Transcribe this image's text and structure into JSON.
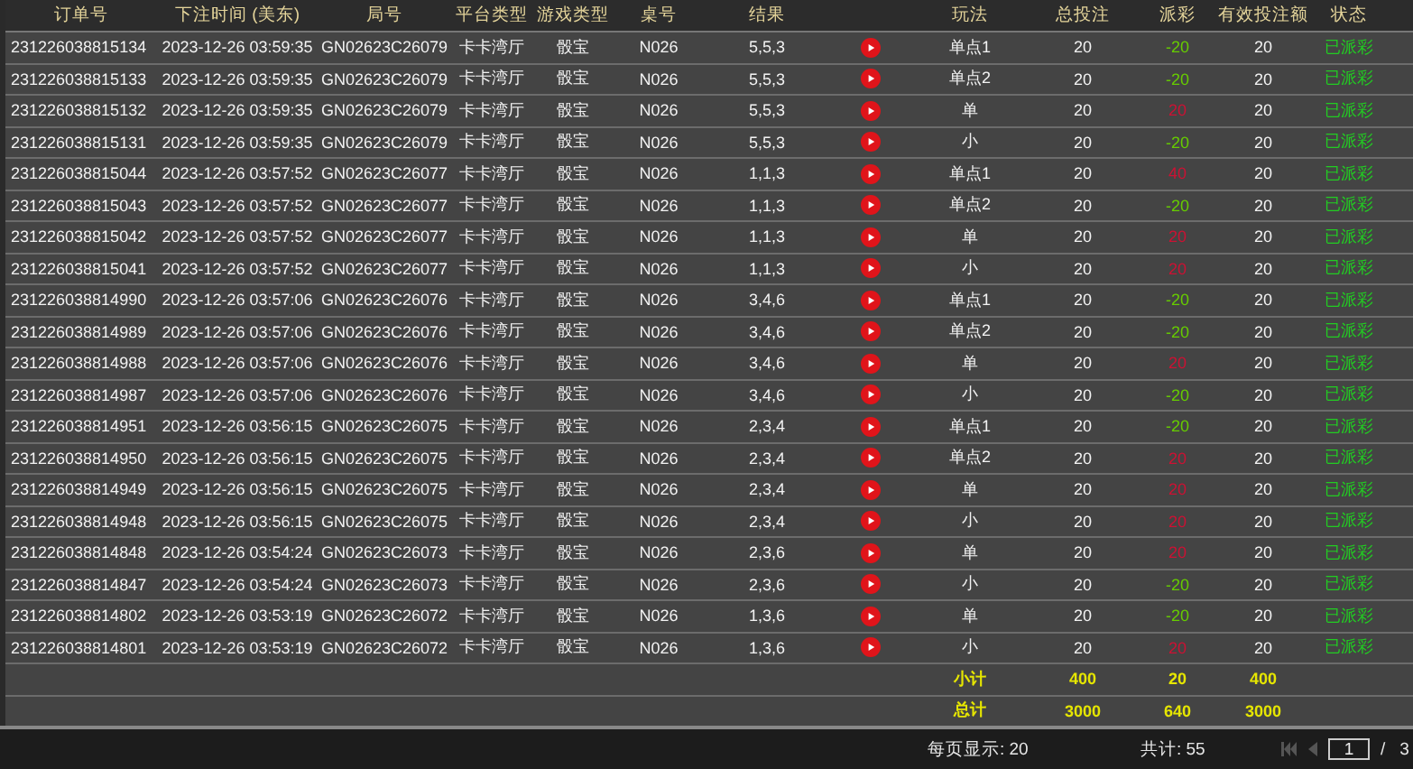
{
  "table": {
    "columns": [
      "订单号",
      "下注时间 (美东)",
      "局号",
      "平台类型",
      "游戏类型",
      "桌号",
      "结果",
      "玩法",
      "总投注",
      "派彩",
      "有效投注额",
      "状态"
    ],
    "rows": [
      {
        "order": "231226038815134",
        "time": "2023-12-26 03:59:35",
        "round": "GN02623C26079",
        "platform": "卡卡湾厅",
        "game": "骰宝",
        "table": "N026",
        "result": "5,5,3",
        "bet": "单点1",
        "stake": "20",
        "payout": {
          "text": "-20",
          "color": "#66cc00"
        },
        "valid": "20",
        "status": "已派彩"
      },
      {
        "order": "231226038815133",
        "time": "2023-12-26 03:59:35",
        "round": "GN02623C26079",
        "platform": "卡卡湾厅",
        "game": "骰宝",
        "table": "N026",
        "result": "5,5,3",
        "bet": "单点2",
        "stake": "20",
        "payout": {
          "text": "-20",
          "color": "#66cc00"
        },
        "valid": "20",
        "status": "已派彩"
      },
      {
        "order": "231226038815132",
        "time": "2023-12-26 03:59:35",
        "round": "GN02623C26079",
        "platform": "卡卡湾厅",
        "game": "骰宝",
        "table": "N026",
        "result": "5,5,3",
        "bet": "单",
        "stake": "20",
        "payout": {
          "text": "20",
          "color": "#cc1133"
        },
        "valid": "20",
        "status": "已派彩"
      },
      {
        "order": "231226038815131",
        "time": "2023-12-26 03:59:35",
        "round": "GN02623C26079",
        "platform": "卡卡湾厅",
        "game": "骰宝",
        "table": "N026",
        "result": "5,5,3",
        "bet": "小",
        "stake": "20",
        "payout": {
          "text": "-20",
          "color": "#66cc00"
        },
        "valid": "20",
        "status": "已派彩"
      },
      {
        "order": "231226038815044",
        "time": "2023-12-26 03:57:52",
        "round": "GN02623C26077",
        "platform": "卡卡湾厅",
        "game": "骰宝",
        "table": "N026",
        "result": "1,1,3",
        "bet": "单点1",
        "stake": "20",
        "payout": {
          "text": "40",
          "color": "#cc1133"
        },
        "valid": "20",
        "status": "已派彩"
      },
      {
        "order": "231226038815043",
        "time": "2023-12-26 03:57:52",
        "round": "GN02623C26077",
        "platform": "卡卡湾厅",
        "game": "骰宝",
        "table": "N026",
        "result": "1,1,3",
        "bet": "单点2",
        "stake": "20",
        "payout": {
          "text": "-20",
          "color": "#66cc00"
        },
        "valid": "20",
        "status": "已派彩"
      },
      {
        "order": "231226038815042",
        "time": "2023-12-26 03:57:52",
        "round": "GN02623C26077",
        "platform": "卡卡湾厅",
        "game": "骰宝",
        "table": "N026",
        "result": "1,1,3",
        "bet": "单",
        "stake": "20",
        "payout": {
          "text": "20",
          "color": "#cc1133"
        },
        "valid": "20",
        "status": "已派彩"
      },
      {
        "order": "231226038815041",
        "time": "2023-12-26 03:57:52",
        "round": "GN02623C26077",
        "platform": "卡卡湾厅",
        "game": "骰宝",
        "table": "N026",
        "result": "1,1,3",
        "bet": "小",
        "stake": "20",
        "payout": {
          "text": "20",
          "color": "#cc1133"
        },
        "valid": "20",
        "status": "已派彩"
      },
      {
        "order": "231226038814990",
        "time": "2023-12-26 03:57:06",
        "round": "GN02623C26076",
        "platform": "卡卡湾厅",
        "game": "骰宝",
        "table": "N026",
        "result": "3,4,6",
        "bet": "单点1",
        "stake": "20",
        "payout": {
          "text": "-20",
          "color": "#66cc00"
        },
        "valid": "20",
        "status": "已派彩"
      },
      {
        "order": "231226038814989",
        "time": "2023-12-26 03:57:06",
        "round": "GN02623C26076",
        "platform": "卡卡湾厅",
        "game": "骰宝",
        "table": "N026",
        "result": "3,4,6",
        "bet": "单点2",
        "stake": "20",
        "payout": {
          "text": "-20",
          "color": "#66cc00"
        },
        "valid": "20",
        "status": "已派彩"
      },
      {
        "order": "231226038814988",
        "time": "2023-12-26 03:57:06",
        "round": "GN02623C26076",
        "platform": "卡卡湾厅",
        "game": "骰宝",
        "table": "N026",
        "result": "3,4,6",
        "bet": "单",
        "stake": "20",
        "payout": {
          "text": "20",
          "color": "#cc1133"
        },
        "valid": "20",
        "status": "已派彩"
      },
      {
        "order": "231226038814987",
        "time": "2023-12-26 03:57:06",
        "round": "GN02623C26076",
        "platform": "卡卡湾厅",
        "game": "骰宝",
        "table": "N026",
        "result": "3,4,6",
        "bet": "小",
        "stake": "20",
        "payout": {
          "text": "-20",
          "color": "#66cc00"
        },
        "valid": "20",
        "status": "已派彩"
      },
      {
        "order": "231226038814951",
        "time": "2023-12-26 03:56:15",
        "round": "GN02623C26075",
        "platform": "卡卡湾厅",
        "game": "骰宝",
        "table": "N026",
        "result": "2,3,4",
        "bet": "单点1",
        "stake": "20",
        "payout": {
          "text": "-20",
          "color": "#66cc00"
        },
        "valid": "20",
        "status": "已派彩"
      },
      {
        "order": "231226038814950",
        "time": "2023-12-26 03:56:15",
        "round": "GN02623C26075",
        "platform": "卡卡湾厅",
        "game": "骰宝",
        "table": "N026",
        "result": "2,3,4",
        "bet": "单点2",
        "stake": "20",
        "payout": {
          "text": "20",
          "color": "#cc1133"
        },
        "valid": "20",
        "status": "已派彩"
      },
      {
        "order": "231226038814949",
        "time": "2023-12-26 03:56:15",
        "round": "GN02623C26075",
        "platform": "卡卡湾厅",
        "game": "骰宝",
        "table": "N026",
        "result": "2,3,4",
        "bet": "单",
        "stake": "20",
        "payout": {
          "text": "20",
          "color": "#cc1133"
        },
        "valid": "20",
        "status": "已派彩"
      },
      {
        "order": "231226038814948",
        "time": "2023-12-26 03:56:15",
        "round": "GN02623C26075",
        "platform": "卡卡湾厅",
        "game": "骰宝",
        "table": "N026",
        "result": "2,3,4",
        "bet": "小",
        "stake": "20",
        "payout": {
          "text": "20",
          "color": "#cc1133"
        },
        "valid": "20",
        "status": "已派彩"
      },
      {
        "order": "231226038814848",
        "time": "2023-12-26 03:54:24",
        "round": "GN02623C26073",
        "platform": "卡卡湾厅",
        "game": "骰宝",
        "table": "N026",
        "result": "2,3,6",
        "bet": "单",
        "stake": "20",
        "payout": {
          "text": "20",
          "color": "#cc1133"
        },
        "valid": "20",
        "status": "已派彩"
      },
      {
        "order": "231226038814847",
        "time": "2023-12-26 03:54:24",
        "round": "GN02623C26073",
        "platform": "卡卡湾厅",
        "game": "骰宝",
        "table": "N026",
        "result": "2,3,6",
        "bet": "小",
        "stake": "20",
        "payout": {
          "text": "-20",
          "color": "#66cc00"
        },
        "valid": "20",
        "status": "已派彩"
      },
      {
        "order": "231226038814802",
        "time": "2023-12-26 03:53:19",
        "round": "GN02623C26072",
        "platform": "卡卡湾厅",
        "game": "骰宝",
        "table": "N026",
        "result": "1,3,6",
        "bet": "单",
        "stake": "20",
        "payout": {
          "text": "-20",
          "color": "#66cc00"
        },
        "valid": "20",
        "status": "已派彩"
      },
      {
        "order": "231226038814801",
        "time": "2023-12-26 03:53:19",
        "round": "GN02623C26072",
        "platform": "卡卡湾厅",
        "game": "骰宝",
        "table": "N026",
        "result": "1,3,6",
        "bet": "小",
        "stake": "20",
        "payout": {
          "text": "20",
          "color": "#cc1133"
        },
        "valid": "20",
        "status": "已派彩"
      }
    ],
    "summary": [
      {
        "label": "小计",
        "stake": "400",
        "payout": "20",
        "valid": "400"
      },
      {
        "label": "总计",
        "stake": "3000",
        "payout": "640",
        "valid": "3000"
      }
    ]
  },
  "pager": {
    "per_page": "每页显示: 20",
    "total": "共计: 55",
    "page": "1",
    "separator": "/",
    "pages": "3"
  }
}
